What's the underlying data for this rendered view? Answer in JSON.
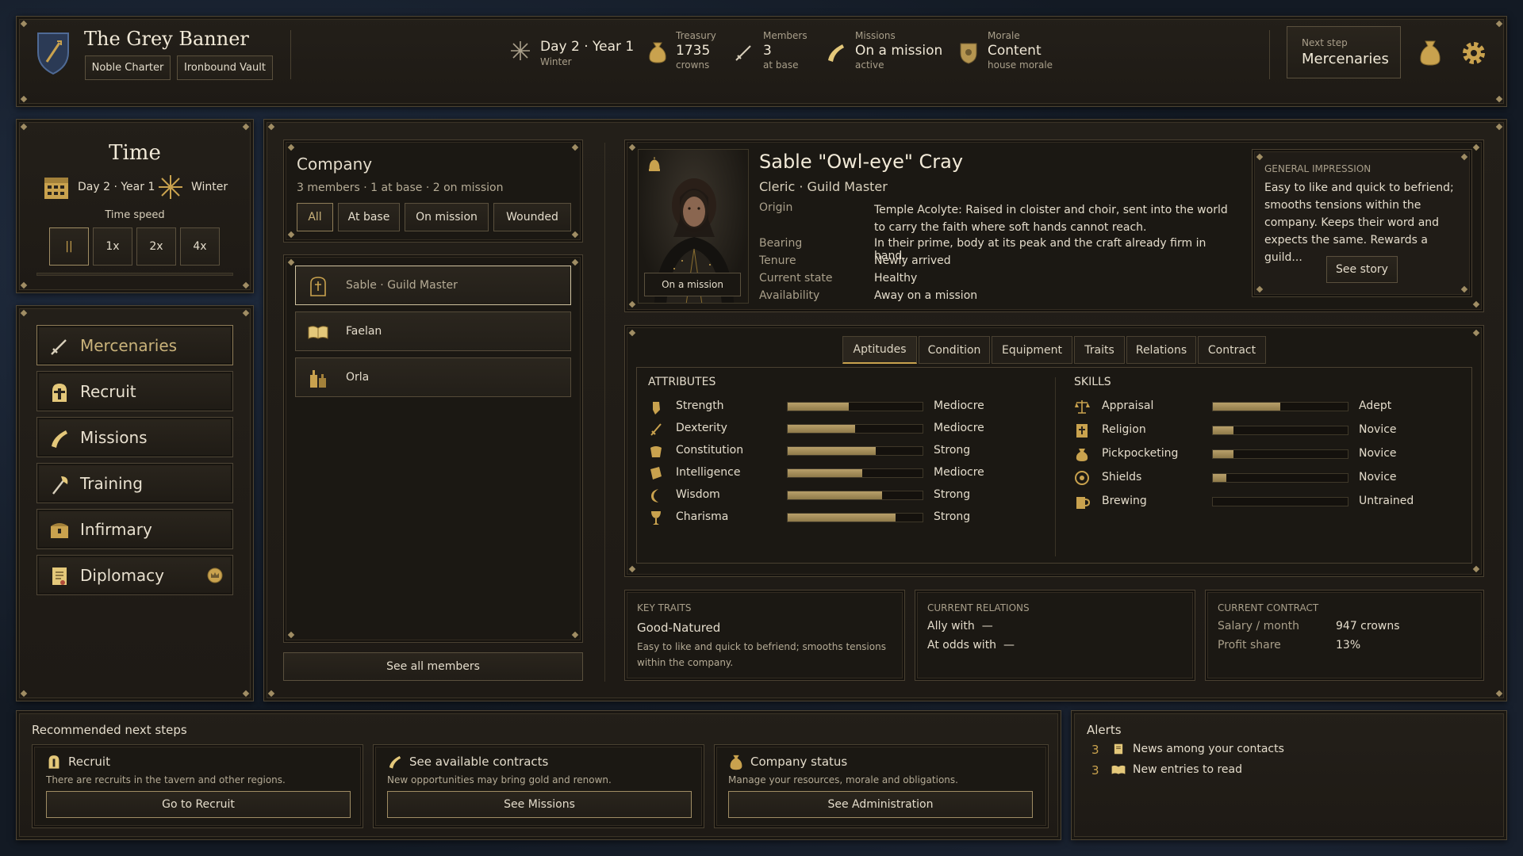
{
  "header": {
    "guild_name": "The Grey Banner",
    "tag1": "Noble Charter",
    "tag2": "Ironbound Vault",
    "date": "Day 2 · Year 1",
    "season": "Winter",
    "treasury_label": "Treasury",
    "treasury_value": "1735",
    "treasury_unit": "crowns",
    "members_label": "Members",
    "members_value": "3",
    "members_sub": "at base",
    "missions_label": "Missions",
    "missions_value": "On a mission",
    "missions_sub": "active",
    "morale_label": "Morale",
    "morale_value": "Content",
    "morale_sub": "house morale",
    "next_step_label": "Next step",
    "next_step_value": "Mercenaries",
    "icons": [
      "shield-crest-icon",
      "snowflake-icon",
      "money-bag-icon",
      "sword-icon",
      "horn-icon",
      "morale-shield-icon",
      "coin-sack-icon",
      "gear-icon"
    ]
  },
  "time_panel": {
    "title": "Time",
    "date": "Day 2 · Year 1",
    "season": "Winter",
    "speed_label": "Time speed",
    "speeds": [
      "||",
      "1x",
      "2x",
      "4x"
    ]
  },
  "nav": {
    "items": [
      {
        "label": "Mercenaries",
        "icon": "sword-icon"
      },
      {
        "label": "Recruit",
        "icon": "helmet-icon"
      },
      {
        "label": "Missions",
        "icon": "horn-icon"
      },
      {
        "label": "Training",
        "icon": "axe-icon"
      },
      {
        "label": "Infirmary",
        "icon": "chest-icon"
      },
      {
        "label": "Diplomacy",
        "icon": "scroll-icon"
      }
    ]
  },
  "company": {
    "title": "Company",
    "summary": "3 members · 1 at base · 2 on mission",
    "filters": [
      "All",
      "At base",
      "On mission",
      "Wounded"
    ],
    "members": [
      {
        "name": "Sable · Guild Master",
        "icon": "tombstone-icon"
      },
      {
        "name": "Faelan",
        "icon": "book-icon"
      },
      {
        "name": "Orla",
        "icon": "bottles-icon"
      }
    ],
    "see_all": "See all members"
  },
  "character": {
    "name": "Sable \"Owl-eye\" Cray",
    "class": "Cleric · Guild Master",
    "portrait_status": "On a mission",
    "fields": [
      {
        "label": "Origin",
        "value": "Temple Acolyte: Raised in cloister and choir, sent into the world to carry the faith where soft hands cannot reach."
      },
      {
        "label": "Bearing",
        "value": "In their prime, body at its peak and the craft already firm in hand."
      },
      {
        "label": "Tenure",
        "value": "Newly arrived"
      },
      {
        "label": "Current state",
        "value": "Healthy"
      },
      {
        "label": "Availability",
        "value": "Away on a mission"
      }
    ],
    "impression_title": "GENERAL IMPRESSION",
    "impression_text": "Easy to like and quick to befriend; smooths tensions within the company. Keeps their word and expects the same. Rewards a guild...",
    "see_story": "See story"
  },
  "tabs": [
    "Aptitudes",
    "Condition",
    "Equipment",
    "Traits",
    "Relations",
    "Contract"
  ],
  "attributes": {
    "title": "ATTRIBUTES",
    "rows": [
      {
        "name": "Strength",
        "level": "Mediocre",
        "fill": 0.45,
        "icon": "fist-icon"
      },
      {
        "name": "Dexterity",
        "level": "Mediocre",
        "fill": 0.5,
        "icon": "dagger-icon"
      },
      {
        "name": "Constitution",
        "level": "Strong",
        "fill": 0.65,
        "icon": "torso-icon"
      },
      {
        "name": "Intelligence",
        "level": "Mediocre",
        "fill": 0.55,
        "icon": "tome-icon"
      },
      {
        "name": "Wisdom",
        "level": "Strong",
        "fill": 0.7,
        "icon": "moon-icon"
      },
      {
        "name": "Charisma",
        "level": "Strong",
        "fill": 0.8,
        "icon": "goblet-icon"
      }
    ]
  },
  "skills": {
    "title": "SKILLS",
    "rows": [
      {
        "name": "Appraisal",
        "level": "Adept",
        "fill": 0.5,
        "icon": "scales-icon"
      },
      {
        "name": "Religion",
        "level": "Novice",
        "fill": 0.15,
        "icon": "holy-book-icon"
      },
      {
        "name": "Pickpocketing",
        "level": "Novice",
        "fill": 0.15,
        "icon": "purse-icon"
      },
      {
        "name": "Shields",
        "level": "Novice",
        "fill": 0.1,
        "icon": "round-shield-icon"
      },
      {
        "name": "Brewing",
        "level": "Untrained",
        "fill": 0,
        "icon": "tankard-icon"
      }
    ]
  },
  "key_traits": {
    "title": "KEY TRAITS",
    "trait": "Good-Natured",
    "desc": "Easy to like and quick to befriend; smooths tensions within the company."
  },
  "relations": {
    "title": "CURRENT RELATIONS",
    "ally": "Ally with  —",
    "odds": "At odds with  —"
  },
  "contract": {
    "title": "CURRENT CONTRACT",
    "salary_label": "Salary / month",
    "salary_value": "947 crowns",
    "profit_label": "Profit share",
    "profit_value": "13%"
  },
  "next_steps": {
    "title": "Recommended next steps",
    "cards": [
      {
        "title": "Recruit",
        "desc": "There are recruits in the tavern and other regions.",
        "button": "Go to Recruit"
      },
      {
        "title": "See available contracts",
        "desc": "New opportunities may bring gold and renown.",
        "button": "See Missions"
      },
      {
        "title": "Company status",
        "desc": "Manage your resources, morale and obligations.",
        "button": "See Administration"
      }
    ]
  },
  "alerts": {
    "title": "Alerts",
    "items": [
      {
        "count": "3",
        "text": "News among your contacts"
      },
      {
        "count": "3",
        "text": "New entries to read"
      }
    ]
  }
}
